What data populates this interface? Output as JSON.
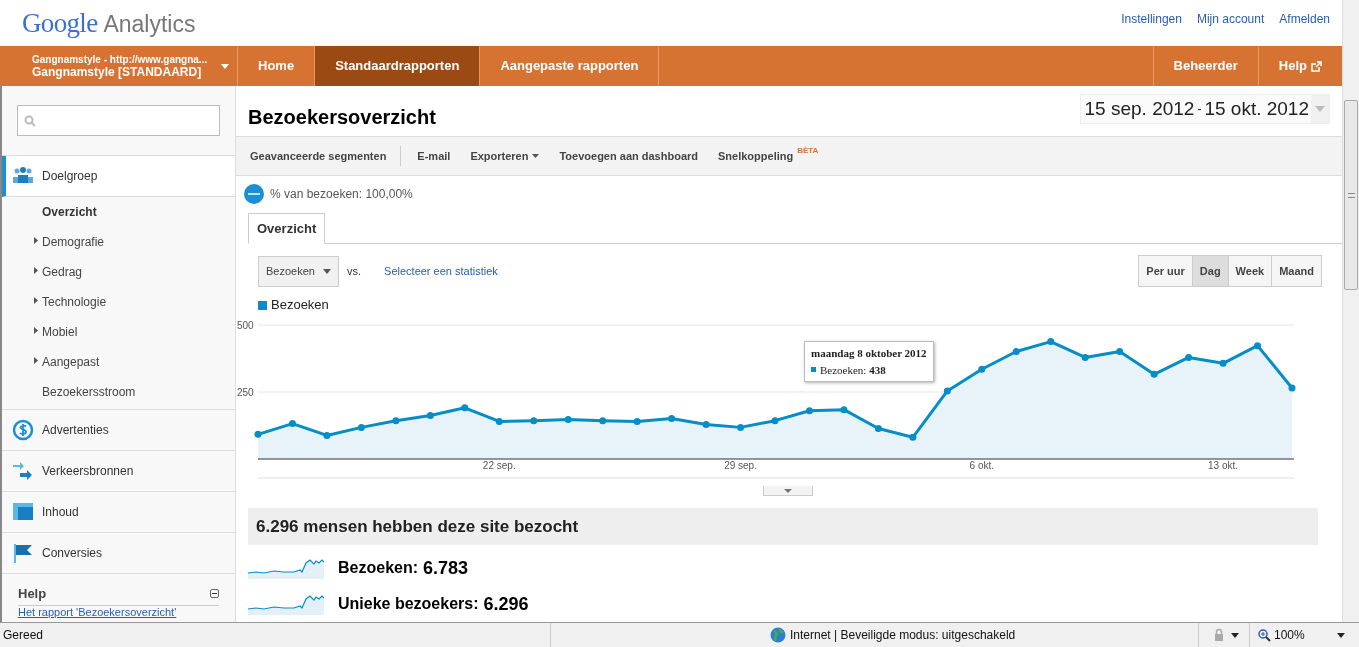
{
  "header": {
    "logo_brand": "Google",
    "logo_product": "Analytics",
    "links": [
      "Instellingen",
      "Mijn account",
      "Afmelden"
    ]
  },
  "navbar": {
    "account": {
      "site": "Gangnamstyle - http://www.gangna...",
      "profile": "Gangnamstyle [STANDAARD]"
    },
    "items": [
      {
        "label": "Home",
        "selected": false
      },
      {
        "label": "Standaardrapporten",
        "selected": true
      },
      {
        "label": "Aangepaste rapporten",
        "selected": false
      }
    ],
    "right_items": [
      {
        "label": "Beheerder",
        "kind": "plain"
      },
      {
        "label": "Help",
        "kind": "external"
      }
    ]
  },
  "sidebar": {
    "sections": [
      {
        "label": "Doelgroep",
        "selected": true,
        "children": [
          {
            "label": "Overzicht",
            "selected": true,
            "expandable": false
          },
          {
            "label": "Demografie",
            "selected": false,
            "expandable": true
          },
          {
            "label": "Gedrag",
            "selected": false,
            "expandable": true
          },
          {
            "label": "Technologie",
            "selected": false,
            "expandable": true
          },
          {
            "label": "Mobiel",
            "selected": false,
            "expandable": true
          },
          {
            "label": "Aangepast",
            "selected": false,
            "expandable": true
          },
          {
            "label": "Bezoekersstroom",
            "selected": false,
            "expandable": false
          }
        ]
      },
      {
        "label": "Advertenties",
        "selected": false
      },
      {
        "label": "Verkeersbronnen",
        "selected": false
      },
      {
        "label": "Inhoud",
        "selected": false
      },
      {
        "label": "Conversies",
        "selected": false
      }
    ],
    "help": {
      "title": "Help",
      "expanded": true,
      "link": "Het rapport 'Bezoekersoverzicht'"
    }
  },
  "report": {
    "title": "Bezoekersoverzicht",
    "date_start": "15 sep. 2012",
    "date_separator": "-",
    "date_end": "15 okt. 2012",
    "toolbar": [
      {
        "label": "Geavanceerde segmenten",
        "kind": "plain"
      },
      {
        "label": "E-mail",
        "kind": "plain"
      },
      {
        "label": "Exporteren",
        "kind": "dropdown"
      },
      {
        "label": "Toevoegen aan dashboard",
        "kind": "plain"
      },
      {
        "label": "Snelkoppeling",
        "kind": "beta",
        "badge": "BÈTA"
      }
    ],
    "segment": "% van bezoeken: 100,00%",
    "tabs": [
      {
        "label": "Overzicht",
        "selected": true
      }
    ],
    "metric_select": "Bezoeken",
    "vs": "vs.",
    "compare_link": "Selecteer een statistiek",
    "periods": [
      {
        "label": "Per uur",
        "selected": false
      },
      {
        "label": "Dag",
        "selected": true
      },
      {
        "label": "Week",
        "selected": false
      },
      {
        "label": "Maand",
        "selected": false
      }
    ],
    "chart_data": {
      "type": "area",
      "categories": [
        null,
        null,
        null,
        null,
        null,
        null,
        null,
        "22 sep.",
        null,
        null,
        null,
        null,
        null,
        null,
        "29 sep.",
        null,
        null,
        null,
        null,
        null,
        null,
        "6 okt.",
        null,
        null,
        null,
        null,
        null,
        null,
        "13 okt.",
        null,
        null
      ],
      "series": [
        {
          "name": "Bezoeken",
          "color": "#058dc7",
          "values": [
            92,
            132,
            88,
            118,
            143,
            162,
            191,
            140,
            143,
            147,
            143,
            140,
            151,
            129,
            118,
            143,
            180,
            184,
            114,
            81,
            254,
            335,
            401,
            438,
            379,
            401,
            316,
            379,
            357,
            423,
            265
          ]
        }
      ],
      "yticks": [
        {
          "value": 250,
          "label": "250"
        },
        {
          "value": 500,
          "label": "500"
        }
      ],
      "ylim": [
        0,
        500
      ]
    },
    "tooltip": {
      "date": "maandag 8 oktober 2012",
      "text": "Bezoeken: **438**"
    },
    "summary": "6.296 mensen hebben deze site bezocht",
    "metrics": [
      {
        "label": "Bezoeken:",
        "value": "6.783"
      },
      {
        "label": "Unieke bezoekers:",
        "value": "6.296"
      }
    ]
  },
  "status_bar": {
    "text": "Gereed",
    "zone": "Internet | Beveiligde modus: uitgeschakeld",
    "zoom": "100%"
  }
}
